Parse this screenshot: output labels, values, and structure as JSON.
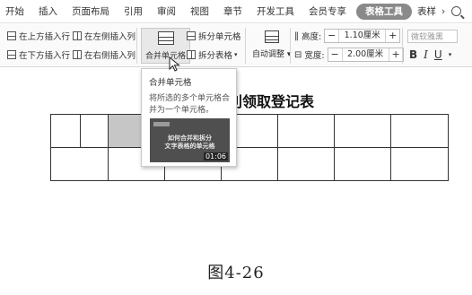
{
  "menu": {
    "tabs": [
      "开始",
      "插入",
      "页面布局",
      "引用",
      "审阅",
      "视图",
      "章节",
      "开发工具",
      "会员专享"
    ],
    "active_tab": "表格工具",
    "cut_tab": "表样"
  },
  "ribbon": {
    "insert_row_above": "在上方插入行",
    "insert_row_below": "在下方插入行",
    "insert_col_left": "在左侧插入列",
    "insert_col_right": "在右侧插入列",
    "merge_cells": "合并单元格",
    "split_cells": "拆分单元格",
    "split_table": "拆分表格",
    "auto_fit": "自动调整",
    "height_label": "高度:",
    "height_value": "1.10厘米",
    "width_label": "宽度:",
    "width_value": "2.00厘米",
    "font_name": "微软雅黑",
    "bold": "B",
    "italic": "I",
    "underline": "U"
  },
  "tooltip": {
    "title": "合并单元格",
    "desc": "将所选的多个单元格合并为一个单元格。",
    "video_title_1": "如何合并和拆分",
    "video_title_2": "文字表格的单元格",
    "video_duration": "01:06"
  },
  "document": {
    "title": "员工福利领取登记表"
  },
  "caption": "图4-26"
}
